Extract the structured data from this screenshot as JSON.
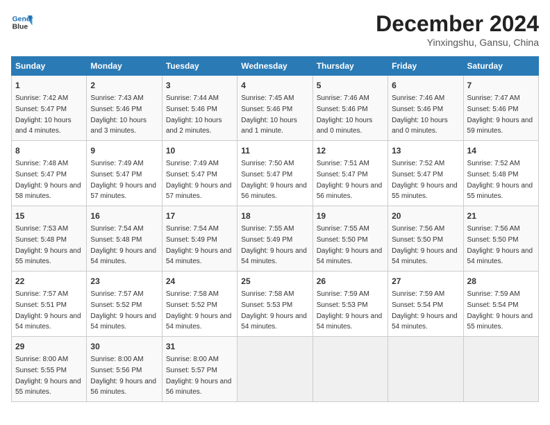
{
  "header": {
    "logo_line1": "General",
    "logo_line2": "Blue",
    "month": "December 2024",
    "location": "Yinxingshu, Gansu, China"
  },
  "weekdays": [
    "Sunday",
    "Monday",
    "Tuesday",
    "Wednesday",
    "Thursday",
    "Friday",
    "Saturday"
  ],
  "weeks": [
    [
      {
        "day": "1",
        "sunrise": "Sunrise: 7:42 AM",
        "sunset": "Sunset: 5:47 PM",
        "daylight": "Daylight: 10 hours and 4 minutes."
      },
      {
        "day": "2",
        "sunrise": "Sunrise: 7:43 AM",
        "sunset": "Sunset: 5:46 PM",
        "daylight": "Daylight: 10 hours and 3 minutes."
      },
      {
        "day": "3",
        "sunrise": "Sunrise: 7:44 AM",
        "sunset": "Sunset: 5:46 PM",
        "daylight": "Daylight: 10 hours and 2 minutes."
      },
      {
        "day": "4",
        "sunrise": "Sunrise: 7:45 AM",
        "sunset": "Sunset: 5:46 PM",
        "daylight": "Daylight: 10 hours and 1 minute."
      },
      {
        "day": "5",
        "sunrise": "Sunrise: 7:46 AM",
        "sunset": "Sunset: 5:46 PM",
        "daylight": "Daylight: 10 hours and 0 minutes."
      },
      {
        "day": "6",
        "sunrise": "Sunrise: 7:46 AM",
        "sunset": "Sunset: 5:46 PM",
        "daylight": "Daylight: 10 hours and 0 minutes."
      },
      {
        "day": "7",
        "sunrise": "Sunrise: 7:47 AM",
        "sunset": "Sunset: 5:46 PM",
        "daylight": "Daylight: 9 hours and 59 minutes."
      }
    ],
    [
      {
        "day": "8",
        "sunrise": "Sunrise: 7:48 AM",
        "sunset": "Sunset: 5:47 PM",
        "daylight": "Daylight: 9 hours and 58 minutes."
      },
      {
        "day": "9",
        "sunrise": "Sunrise: 7:49 AM",
        "sunset": "Sunset: 5:47 PM",
        "daylight": "Daylight: 9 hours and 57 minutes."
      },
      {
        "day": "10",
        "sunrise": "Sunrise: 7:49 AM",
        "sunset": "Sunset: 5:47 PM",
        "daylight": "Daylight: 9 hours and 57 minutes."
      },
      {
        "day": "11",
        "sunrise": "Sunrise: 7:50 AM",
        "sunset": "Sunset: 5:47 PM",
        "daylight": "Daylight: 9 hours and 56 minutes."
      },
      {
        "day": "12",
        "sunrise": "Sunrise: 7:51 AM",
        "sunset": "Sunset: 5:47 PM",
        "daylight": "Daylight: 9 hours and 56 minutes."
      },
      {
        "day": "13",
        "sunrise": "Sunrise: 7:52 AM",
        "sunset": "Sunset: 5:47 PM",
        "daylight": "Daylight: 9 hours and 55 minutes."
      },
      {
        "day": "14",
        "sunrise": "Sunrise: 7:52 AM",
        "sunset": "Sunset: 5:48 PM",
        "daylight": "Daylight: 9 hours and 55 minutes."
      }
    ],
    [
      {
        "day": "15",
        "sunrise": "Sunrise: 7:53 AM",
        "sunset": "Sunset: 5:48 PM",
        "daylight": "Daylight: 9 hours and 55 minutes."
      },
      {
        "day": "16",
        "sunrise": "Sunrise: 7:54 AM",
        "sunset": "Sunset: 5:48 PM",
        "daylight": "Daylight: 9 hours and 54 minutes."
      },
      {
        "day": "17",
        "sunrise": "Sunrise: 7:54 AM",
        "sunset": "Sunset: 5:49 PM",
        "daylight": "Daylight: 9 hours and 54 minutes."
      },
      {
        "day": "18",
        "sunrise": "Sunrise: 7:55 AM",
        "sunset": "Sunset: 5:49 PM",
        "daylight": "Daylight: 9 hours and 54 minutes."
      },
      {
        "day": "19",
        "sunrise": "Sunrise: 7:55 AM",
        "sunset": "Sunset: 5:50 PM",
        "daylight": "Daylight: 9 hours and 54 minutes."
      },
      {
        "day": "20",
        "sunrise": "Sunrise: 7:56 AM",
        "sunset": "Sunset: 5:50 PM",
        "daylight": "Daylight: 9 hours and 54 minutes."
      },
      {
        "day": "21",
        "sunrise": "Sunrise: 7:56 AM",
        "sunset": "Sunset: 5:50 PM",
        "daylight": "Daylight: 9 hours and 54 minutes."
      }
    ],
    [
      {
        "day": "22",
        "sunrise": "Sunrise: 7:57 AM",
        "sunset": "Sunset: 5:51 PM",
        "daylight": "Daylight: 9 hours and 54 minutes."
      },
      {
        "day": "23",
        "sunrise": "Sunrise: 7:57 AM",
        "sunset": "Sunset: 5:52 PM",
        "daylight": "Daylight: 9 hours and 54 minutes."
      },
      {
        "day": "24",
        "sunrise": "Sunrise: 7:58 AM",
        "sunset": "Sunset: 5:52 PM",
        "daylight": "Daylight: 9 hours and 54 minutes."
      },
      {
        "day": "25",
        "sunrise": "Sunrise: 7:58 AM",
        "sunset": "Sunset: 5:53 PM",
        "daylight": "Daylight: 9 hours and 54 minutes."
      },
      {
        "day": "26",
        "sunrise": "Sunrise: 7:59 AM",
        "sunset": "Sunset: 5:53 PM",
        "daylight": "Daylight: 9 hours and 54 minutes."
      },
      {
        "day": "27",
        "sunrise": "Sunrise: 7:59 AM",
        "sunset": "Sunset: 5:54 PM",
        "daylight": "Daylight: 9 hours and 54 minutes."
      },
      {
        "day": "28",
        "sunrise": "Sunrise: 7:59 AM",
        "sunset": "Sunset: 5:54 PM",
        "daylight": "Daylight: 9 hours and 55 minutes."
      }
    ],
    [
      {
        "day": "29",
        "sunrise": "Sunrise: 8:00 AM",
        "sunset": "Sunset: 5:55 PM",
        "daylight": "Daylight: 9 hours and 55 minutes."
      },
      {
        "day": "30",
        "sunrise": "Sunrise: 8:00 AM",
        "sunset": "Sunset: 5:56 PM",
        "daylight": "Daylight: 9 hours and 56 minutes."
      },
      {
        "day": "31",
        "sunrise": "Sunrise: 8:00 AM",
        "sunset": "Sunset: 5:57 PM",
        "daylight": "Daylight: 9 hours and 56 minutes."
      },
      null,
      null,
      null,
      null
    ]
  ]
}
